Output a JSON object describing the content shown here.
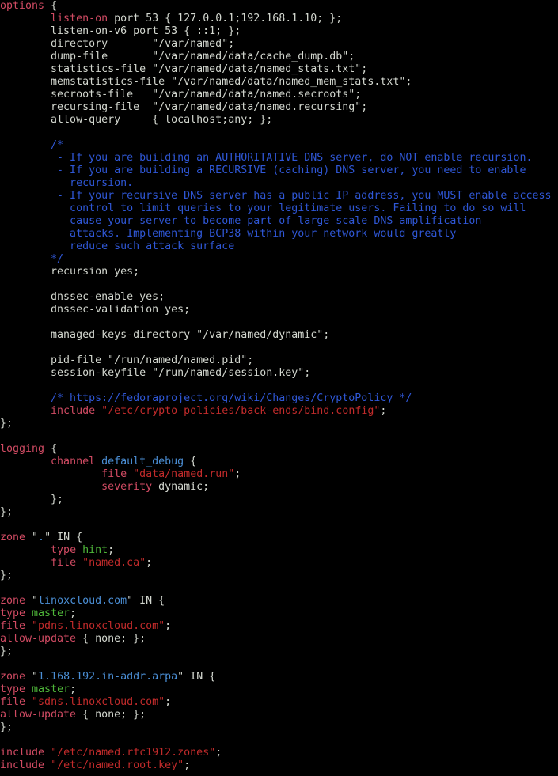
{
  "colors": {
    "default": "#d3d7cf",
    "keyword": "#d14b63",
    "string": "#c22b2b",
    "type_value": "#4fb83a",
    "comment": "#2f57d6",
    "channel_name": "#4b8fd6",
    "zone_name": "#4b8fd6",
    "background": "#000000"
  },
  "lines": [
    {
      "segments": [
        {
          "t": "options",
          "c": "keyword"
        },
        {
          "t": " {",
          "c": "default"
        }
      ]
    },
    {
      "segments": [
        {
          "t": "        ",
          "c": "default"
        },
        {
          "t": "listen-on",
          "c": "keyword"
        },
        {
          "t": " port 53 { 127.0.0.1;192.168.1.10; };",
          "c": "default"
        }
      ]
    },
    {
      "segments": [
        {
          "t": "        listen-on-v6 port 53 { ::1; };",
          "c": "default"
        }
      ]
    },
    {
      "segments": [
        {
          "t": "        directory       \"/var/named\";",
          "c": "default"
        }
      ]
    },
    {
      "segments": [
        {
          "t": "        dump-file       \"/var/named/data/cache_dump.db\";",
          "c": "default"
        }
      ]
    },
    {
      "segments": [
        {
          "t": "        statistics-file \"/var/named/data/named_stats.txt\";",
          "c": "default"
        }
      ]
    },
    {
      "segments": [
        {
          "t": "        memstatistics-file \"/var/named/data/named_mem_stats.txt\";",
          "c": "default"
        }
      ]
    },
    {
      "segments": [
        {
          "t": "        secroots-file   \"/var/named/data/named.secroots\";",
          "c": "default"
        }
      ]
    },
    {
      "segments": [
        {
          "t": "        recursing-file  \"/var/named/data/named.recursing\";",
          "c": "default"
        }
      ]
    },
    {
      "segments": [
        {
          "t": "        allow-query     { localhost;any; };",
          "c": "default"
        }
      ]
    },
    {
      "segments": []
    },
    {
      "segments": [
        {
          "t": "        /*",
          "c": "comment"
        }
      ]
    },
    {
      "segments": [
        {
          "t": "         - If you are building an AUTHORITATIVE DNS server, do NOT enable recursion.",
          "c": "comment"
        }
      ]
    },
    {
      "segments": [
        {
          "t": "         - If you are building a RECURSIVE (caching) DNS server, you need to enable",
          "c": "comment"
        }
      ]
    },
    {
      "segments": [
        {
          "t": "           recursion.",
          "c": "comment"
        }
      ]
    },
    {
      "segments": [
        {
          "t": "         - If your recursive DNS server has a public IP address, you MUST enable access",
          "c": "comment"
        }
      ]
    },
    {
      "segments": [
        {
          "t": "           control to limit queries to your legitimate users. Failing to do so will",
          "c": "comment"
        }
      ]
    },
    {
      "segments": [
        {
          "t": "           cause your server to become part of large scale DNS amplification",
          "c": "comment"
        }
      ]
    },
    {
      "segments": [
        {
          "t": "           attacks. Implementing BCP38 within your network would greatly",
          "c": "comment"
        }
      ]
    },
    {
      "segments": [
        {
          "t": "           reduce such attack surface",
          "c": "comment"
        }
      ]
    },
    {
      "segments": [
        {
          "t": "        */",
          "c": "comment"
        }
      ]
    },
    {
      "segments": [
        {
          "t": "        recursion yes;",
          "c": "default"
        }
      ]
    },
    {
      "segments": []
    },
    {
      "segments": [
        {
          "t": "        dnssec-enable yes;",
          "c": "default"
        }
      ]
    },
    {
      "segments": [
        {
          "t": "        dnssec-validation yes;",
          "c": "default"
        }
      ]
    },
    {
      "segments": []
    },
    {
      "segments": [
        {
          "t": "        managed-keys-directory \"/var/named/dynamic\";",
          "c": "default"
        }
      ]
    },
    {
      "segments": []
    },
    {
      "segments": [
        {
          "t": "        pid-file \"/run/named/named.pid\";",
          "c": "default"
        }
      ]
    },
    {
      "segments": [
        {
          "t": "        session-keyfile \"/run/named/session.key\";",
          "c": "default"
        }
      ]
    },
    {
      "segments": []
    },
    {
      "segments": [
        {
          "t": "        /* https://fedoraproject.org/wiki/Changes/CryptoPolicy */",
          "c": "comment"
        }
      ]
    },
    {
      "segments": [
        {
          "t": "        ",
          "c": "default"
        },
        {
          "t": "include",
          "c": "keyword"
        },
        {
          "t": " ",
          "c": "default"
        },
        {
          "t": "\"/etc/crypto-policies/back-ends/bind.config\"",
          "c": "string"
        },
        {
          "t": ";",
          "c": "default"
        }
      ]
    },
    {
      "segments": [
        {
          "t": "};",
          "c": "default"
        }
      ]
    },
    {
      "segments": []
    },
    {
      "segments": [
        {
          "t": "logging",
          "c": "keyword"
        },
        {
          "t": " {",
          "c": "default"
        }
      ]
    },
    {
      "segments": [
        {
          "t": "        ",
          "c": "default"
        },
        {
          "t": "channel",
          "c": "keyword"
        },
        {
          "t": " ",
          "c": "default"
        },
        {
          "t": "default_debug",
          "c": "channel_name"
        },
        {
          "t": " {",
          "c": "default"
        }
      ]
    },
    {
      "segments": [
        {
          "t": "                ",
          "c": "default"
        },
        {
          "t": "file",
          "c": "keyword"
        },
        {
          "t": " ",
          "c": "default"
        },
        {
          "t": "\"data/named.run\"",
          "c": "string"
        },
        {
          "t": ";",
          "c": "default"
        }
      ]
    },
    {
      "segments": [
        {
          "t": "                ",
          "c": "default"
        },
        {
          "t": "severity",
          "c": "keyword"
        },
        {
          "t": " dynamic;",
          "c": "default"
        }
      ]
    },
    {
      "segments": [
        {
          "t": "        };",
          "c": "default"
        }
      ]
    },
    {
      "segments": [
        {
          "t": "};",
          "c": "default"
        }
      ]
    },
    {
      "segments": []
    },
    {
      "segments": [
        {
          "t": "zone",
          "c": "keyword"
        },
        {
          "t": " \"",
          "c": "default"
        },
        {
          "t": ".",
          "c": "zone_name"
        },
        {
          "t": "\" IN {",
          "c": "default"
        }
      ]
    },
    {
      "segments": [
        {
          "t": "        ",
          "c": "default"
        },
        {
          "t": "type",
          "c": "keyword"
        },
        {
          "t": " ",
          "c": "default"
        },
        {
          "t": "hint",
          "c": "type_value"
        },
        {
          "t": ";",
          "c": "default"
        }
      ]
    },
    {
      "segments": [
        {
          "t": "        ",
          "c": "default"
        },
        {
          "t": "file",
          "c": "keyword"
        },
        {
          "t": " ",
          "c": "default"
        },
        {
          "t": "\"named.ca\"",
          "c": "string"
        },
        {
          "t": ";",
          "c": "default"
        }
      ]
    },
    {
      "segments": [
        {
          "t": "};",
          "c": "default"
        }
      ]
    },
    {
      "segments": []
    },
    {
      "segments": [
        {
          "t": "zone",
          "c": "keyword"
        },
        {
          "t": " \"",
          "c": "default"
        },
        {
          "t": "linoxcloud.com",
          "c": "zone_name"
        },
        {
          "t": "\" IN {",
          "c": "default"
        }
      ]
    },
    {
      "segments": [
        {
          "t": "type",
          "c": "keyword"
        },
        {
          "t": " ",
          "c": "default"
        },
        {
          "t": "master",
          "c": "type_value"
        },
        {
          "t": ";",
          "c": "default"
        }
      ]
    },
    {
      "segments": [
        {
          "t": "file",
          "c": "keyword"
        },
        {
          "t": " ",
          "c": "default"
        },
        {
          "t": "\"pdns.linoxcloud.com\"",
          "c": "string"
        },
        {
          "t": ";",
          "c": "default"
        }
      ]
    },
    {
      "segments": [
        {
          "t": "allow-update",
          "c": "keyword"
        },
        {
          "t": " { none; };",
          "c": "default"
        }
      ]
    },
    {
      "segments": [
        {
          "t": "};",
          "c": "default"
        }
      ]
    },
    {
      "segments": []
    },
    {
      "segments": [
        {
          "t": "zone",
          "c": "keyword"
        },
        {
          "t": " \"",
          "c": "default"
        },
        {
          "t": "1.168.192.in-addr.arpa",
          "c": "zone_name"
        },
        {
          "t": "\" IN {",
          "c": "default"
        }
      ]
    },
    {
      "segments": [
        {
          "t": "type",
          "c": "keyword"
        },
        {
          "t": " ",
          "c": "default"
        },
        {
          "t": "master",
          "c": "type_value"
        },
        {
          "t": ";",
          "c": "default"
        }
      ]
    },
    {
      "segments": [
        {
          "t": "file",
          "c": "keyword"
        },
        {
          "t": " ",
          "c": "default"
        },
        {
          "t": "\"sdns.linoxcloud.com\"",
          "c": "string"
        },
        {
          "t": ";",
          "c": "default"
        }
      ]
    },
    {
      "segments": [
        {
          "t": "allow-update",
          "c": "keyword"
        },
        {
          "t": " { none; };",
          "c": "default"
        }
      ]
    },
    {
      "segments": [
        {
          "t": "};",
          "c": "default"
        }
      ]
    },
    {
      "segments": []
    },
    {
      "segments": [
        {
          "t": "include",
          "c": "keyword"
        },
        {
          "t": " ",
          "c": "default"
        },
        {
          "t": "\"/etc/named.rfc1912.zones\"",
          "c": "string"
        },
        {
          "t": ";",
          "c": "default"
        }
      ]
    },
    {
      "segments": [
        {
          "t": "include",
          "c": "keyword"
        },
        {
          "t": " ",
          "c": "default"
        },
        {
          "t": "\"/etc/named.root.key\"",
          "c": "string"
        },
        {
          "t": ";",
          "c": "default"
        }
      ]
    }
  ]
}
